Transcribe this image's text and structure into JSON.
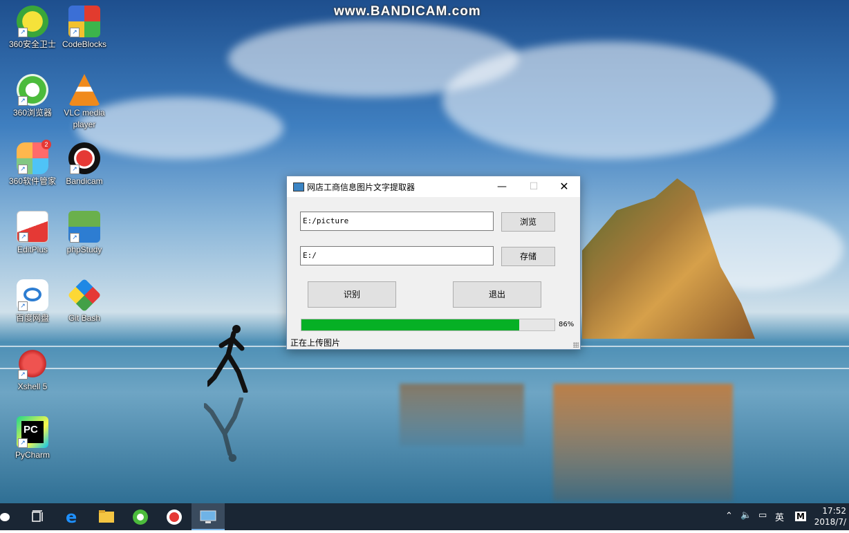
{
  "watermark": "www.BANDICAM.com",
  "desktop_icons": [
    {
      "label": "360安全卫士"
    },
    {
      "label": "CodeBlocks"
    },
    {
      "label": "360浏览器"
    },
    {
      "label": "VLC media player"
    },
    {
      "label": "360软件管家",
      "badge": "2"
    },
    {
      "label": "Bandicam"
    },
    {
      "label": "EditPlus"
    },
    {
      "label": "phpStudy"
    },
    {
      "label": "百度网盘"
    },
    {
      "label": "Git Bash"
    },
    {
      "label": "Xshell 5"
    },
    {
      "label": "PyCharm",
      "icon_text": "PC"
    }
  ],
  "dialog": {
    "title": "网店工商信息图片文字提取器",
    "source_path": "E:/picture",
    "browse_label": "浏览",
    "output_path": "E:/",
    "save_label": "存储",
    "recognize_label": "识别",
    "exit_label": "退出",
    "progress": 86,
    "progress_text": "86%",
    "status": "正在上传图片",
    "colors": {
      "progress": "#06b025"
    }
  },
  "taskbar": {
    "ime": "英",
    "ime_mode": "M",
    "time": "17:52",
    "date": "2018/7/"
  }
}
